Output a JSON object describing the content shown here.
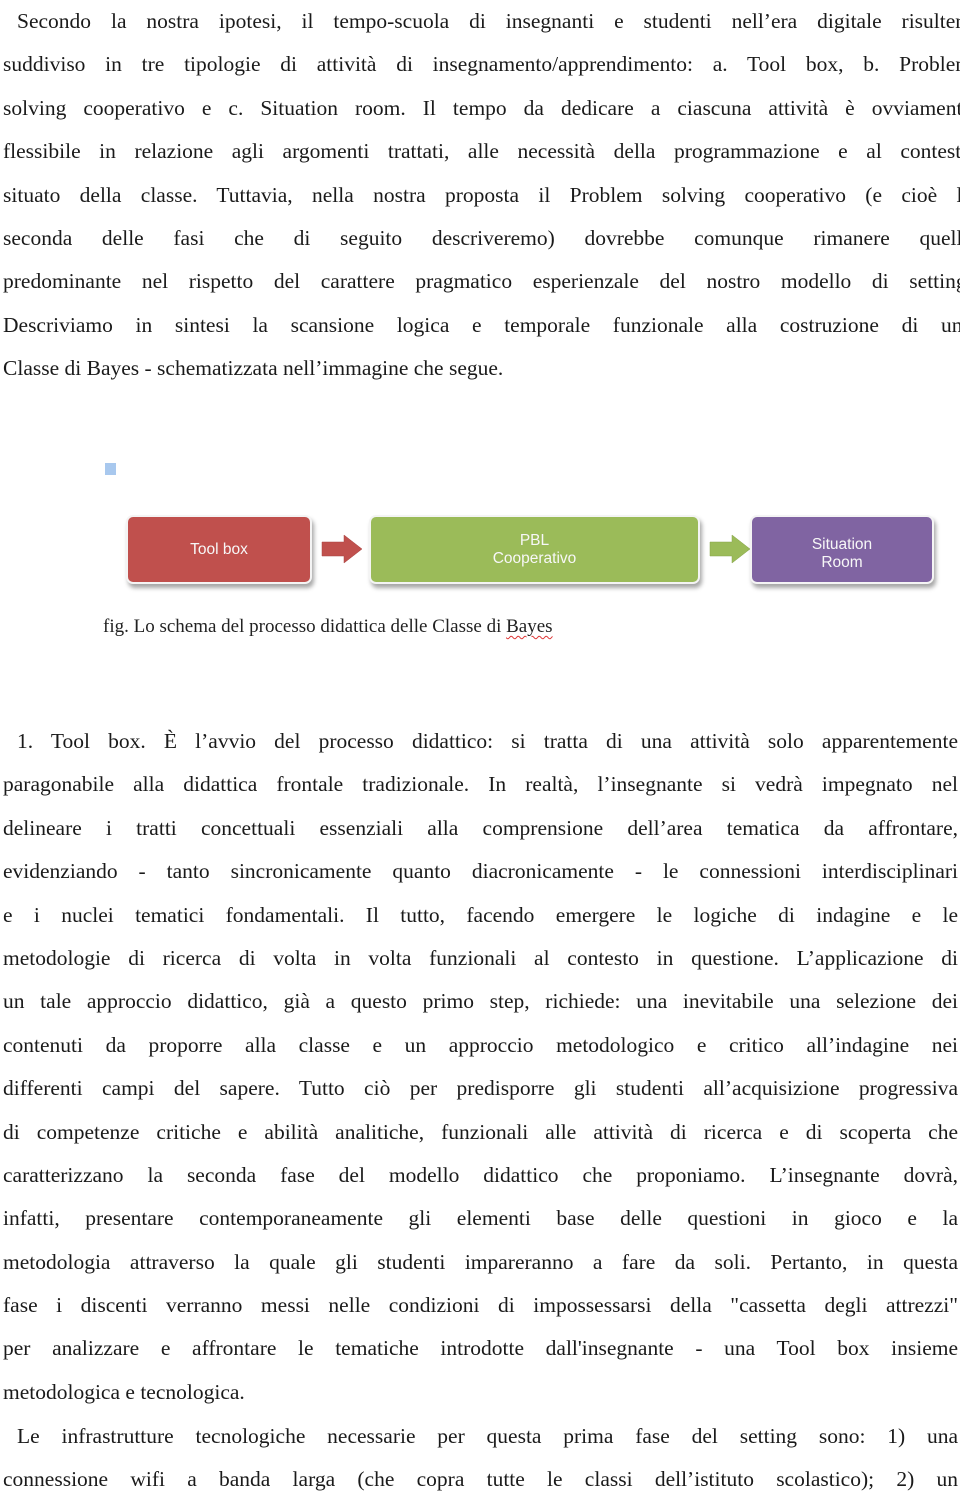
{
  "intro_paragraph": {
    "lines": [
      "Secondo la nostra ipotesi, il tempo-scuola di insegnanti e studenti nell’era digitale risulterà",
      "suddiviso in tre tipologie di attività di insegnamento/apprendimento: a. Tool box, b. Problem",
      "solving cooperativo e c. Situation room. Il tempo da dedicare a ciascuna attività è ovviamente",
      "flessibile in relazione agli argomenti trattati, alle necessità della programmazione e al contesto",
      "situato della classe. Tuttavia, nella nostra proposta il Problem solving cooperativo (e cioè la",
      "seconda delle fasi che di seguito descriveremo) dovrebbe comunque rimanere quella",
      "predominante nel rispetto del carattere pragmatico esperienzale del nostro modello di setting.",
      "Descriviamo in sintesi la scansione logica e temporale funzionale alla costruzione di una",
      "Classe di Bayes - schematizzata nell’immagine che segue."
    ]
  },
  "figure": {
    "steps": [
      {
        "lines": [
          "Tool box"
        ],
        "color": "#c0504d"
      },
      {
        "lines": [
          "PBL",
          "Cooperativo"
        ],
        "color": "#9bbb59"
      },
      {
        "lines": [
          "Situation",
          "Room"
        ],
        "color": "#8064a2"
      }
    ],
    "caption_prefix": "fig. Lo schema del processo didattica delle Classe di ",
    "caption_flagged_word": "Bayes"
  },
  "tool_box_paragraph": {
    "lines": [
      "1. Tool box. È l’avvio del processo didattico: si tratta di una attività solo apparentemente",
      "paragonabile alla didattica frontale tradizionale. In realtà, l’insegnante si vedrà impegnato nel",
      "delineare i tratti concettuali essenziali alla comprensione dell’area tematica da affrontare,",
      "evidenziando - tanto sincronicamente quanto diacronicamente - le connessioni interdisciplinari",
      "e i nuclei tematici fondamentali. Il tutto, facendo emergere le logiche di indagine e le",
      "metodologie di ricerca di volta in volta funzionali al contesto in questione. L’applicazione di",
      "un tale approccio didattico, già a questo primo step, richiede: una inevitabile una selezione dei",
      "contenuti da proporre alla classe e un approccio metodologico e critico all’indagine nei",
      "differenti campi del sapere. Tutto ciò per predisporre gli studenti all’acquisizione progressiva",
      "di competenze critiche e abilità analitiche, funzionali alle attività di ricerca e di scoperta che",
      "caratterizzano la seconda fase del modello didattico che proponiamo. L’insegnante dovrà,",
      "infatti, presentare contemporaneamente gli elementi base delle questioni in gioco e la",
      "metodologia attraverso la quale gli studenti impareranno a fare da soli. Pertanto, in questa",
      "fase i discenti verranno messi nelle condizioni di impossessarsi della \"cassetta degli attrezzi\"",
      "per analizzare e affrontare le tematiche introdotte dall'insegnante - una Tool box insieme",
      "metodologica e tecnologica."
    ]
  },
  "infrastructure_paragraph": {
    "lines": [
      "Le infrastrutture tecnologiche necessarie per questa prima fase del setting sono: 1) una",
      "connessione wifi a banda larga (che copra tutte le classi dell’istituto scolastico); 2) un"
    ]
  }
}
